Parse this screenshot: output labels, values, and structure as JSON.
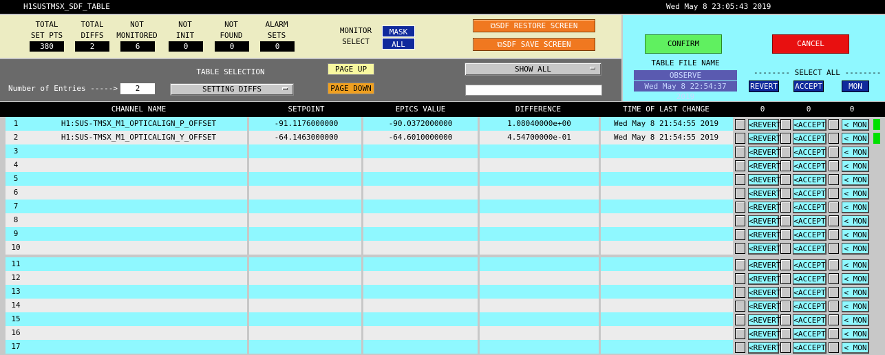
{
  "window": {
    "title": "H1SUSTMSX_SDF_TABLE",
    "datetime": "Wed May  8 23:05:43 2019"
  },
  "summary": {
    "stats": [
      {
        "label": "TOTAL\nSET PTS",
        "value": "380"
      },
      {
        "label": "TOTAL\nDIFFS",
        "value": "2"
      },
      {
        "label": "NOT\nMONITORED",
        "value": "6"
      },
      {
        "label": "NOT\nINIT",
        "value": "0"
      },
      {
        "label": "NOT\nFOUND",
        "value": "0"
      },
      {
        "label": "ALARM\nSETS",
        "value": "0"
      }
    ],
    "monitor_select_label": "MONITOR\nSELECT",
    "mask_label": "MASK",
    "all_label": "ALL",
    "restore_label": "SDF RESTORE SCREEN",
    "save_label": "SDF SAVE SCREEN"
  },
  "controls": {
    "entries_label": "Number of Entries ----->",
    "entries_value": "2",
    "table_selection_label": "TABLE SELECTION",
    "table_selection_value": "SETTING DIFFS",
    "page_up_label": "PAGE UP",
    "page_down_label": "PAGE DOWN",
    "show_all_label": "SHOW ALL",
    "filter_value": ""
  },
  "right_panel": {
    "confirm_label": "CONFIRM",
    "cancel_label": "CANCEL",
    "table_file_name_label": "TABLE FILE NAME",
    "table_file_name": "OBSERVE",
    "file_date": "Wed May  8 22:54:37 2019",
    "select_all_label": "-------- SELECT ALL --------",
    "revert_label": "REVERT",
    "accept_label": "ACCEPT",
    "mon_label": "MON"
  },
  "table": {
    "headers": {
      "channel": "CHANNEL NAME",
      "setpoint": "SETPOINT",
      "epics": "EPICS VALUE",
      "difference": "DIFFERENCE",
      "time": "TIME OF LAST CHANGE",
      "count1": "0",
      "count2": "0",
      "count3": "0"
    },
    "row_buttons": {
      "revert": "<REVERT",
      "accept": "<ACCEPT",
      "mon": "< MON"
    },
    "rows": [
      {
        "num": "1",
        "channel": "H1:SUS-TMSX_M1_OPTICALIGN_P_OFFSET",
        "setpoint": "-91.1176000000",
        "epics": "-90.0372000000",
        "difference": "1.08040000e+00",
        "time": "Wed May  8 21:54:55 2019"
      },
      {
        "num": "2",
        "channel": "H1:SUS-TMSX_M1_OPTICALIGN_Y_OFFSET",
        "setpoint": "-64.1463000000",
        "epics": "-64.6010000000",
        "difference": "4.54700000e-01",
        "time": "Wed May  8 21:54:55 2019"
      },
      {
        "num": "3",
        "channel": "",
        "setpoint": "",
        "epics": "",
        "difference": "",
        "time": ""
      },
      {
        "num": "4",
        "channel": "",
        "setpoint": "",
        "epics": "",
        "difference": "",
        "time": ""
      },
      {
        "num": "5",
        "channel": "",
        "setpoint": "",
        "epics": "",
        "difference": "",
        "time": ""
      },
      {
        "num": "6",
        "channel": "",
        "setpoint": "",
        "epics": "",
        "difference": "",
        "time": ""
      },
      {
        "num": "7",
        "channel": "",
        "setpoint": "",
        "epics": "",
        "difference": "",
        "time": ""
      },
      {
        "num": "8",
        "channel": "",
        "setpoint": "",
        "epics": "",
        "difference": "",
        "time": ""
      },
      {
        "num": "9",
        "channel": "",
        "setpoint": "",
        "epics": "",
        "difference": "",
        "time": ""
      },
      {
        "num": "10",
        "channel": "",
        "setpoint": "",
        "epics": "",
        "difference": "",
        "time": ""
      },
      {
        "num": "11",
        "channel": "",
        "setpoint": "",
        "epics": "",
        "difference": "",
        "time": ""
      },
      {
        "num": "12",
        "channel": "",
        "setpoint": "",
        "epics": "",
        "difference": "",
        "time": ""
      },
      {
        "num": "13",
        "channel": "",
        "setpoint": "",
        "epics": "",
        "difference": "",
        "time": ""
      },
      {
        "num": "14",
        "channel": "",
        "setpoint": "",
        "epics": "",
        "difference": "",
        "time": ""
      },
      {
        "num": "15",
        "channel": "",
        "setpoint": "",
        "epics": "",
        "difference": "",
        "time": ""
      },
      {
        "num": "16",
        "channel": "",
        "setpoint": "",
        "epics": "",
        "difference": "",
        "time": ""
      },
      {
        "num": "17",
        "channel": "",
        "setpoint": "",
        "epics": "",
        "difference": "",
        "time": ""
      }
    ]
  },
  "colors": {
    "cyan": "#8ff8ff",
    "gray_row": "#ececec",
    "orange": "#f07820",
    "green": "#00e800",
    "red": "#e81010",
    "navy": "#102a9c",
    "status_green": "#00e000"
  }
}
